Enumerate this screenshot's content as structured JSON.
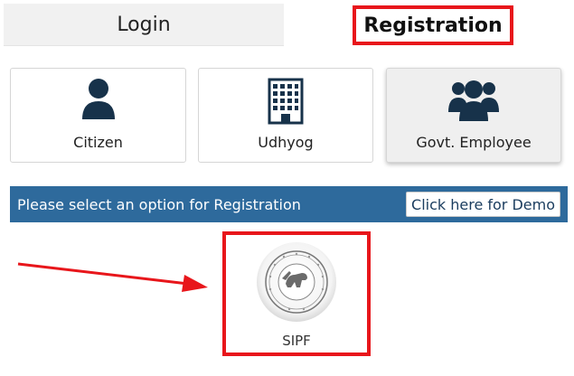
{
  "tabs": {
    "login": "Login",
    "registration": "Registration"
  },
  "options": [
    {
      "label": "Citizen",
      "icon": "user-icon"
    },
    {
      "label": "Udhyog",
      "icon": "building-icon"
    },
    {
      "label": "Govt. Employee",
      "icon": "group-icon"
    }
  ],
  "bar": {
    "text": "Please select an option for Registration",
    "demo_label": "Click here for Demo"
  },
  "sipf": {
    "label": "SIPF",
    "logo_icon": "sipf-emblem-icon"
  },
  "colors": {
    "highlight": "#e8161b",
    "bar": "#2e6a9c",
    "icon": "#17324a"
  }
}
